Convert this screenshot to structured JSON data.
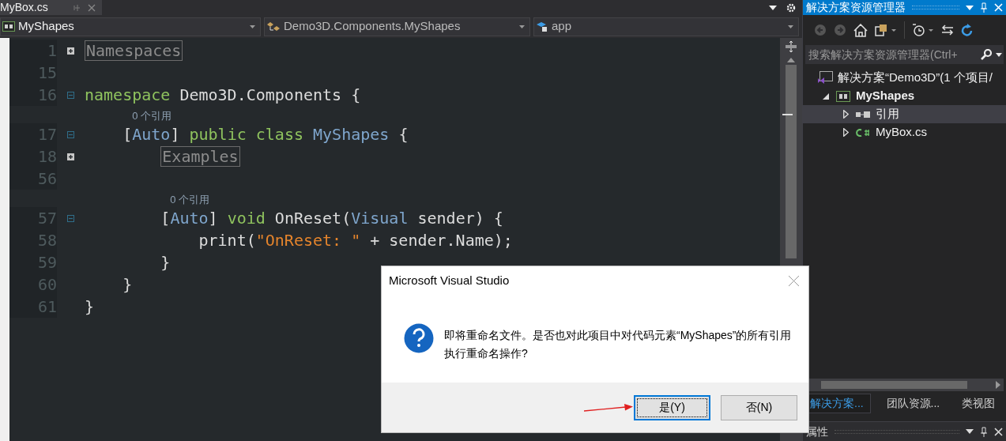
{
  "document_tab": {
    "title": "MyBox.cs"
  },
  "nav_bar": [
    {
      "text": "MyShapes",
      "kind": "project"
    },
    {
      "text": "Demo3D.Components.MyShapes",
      "kind": "class"
    },
    {
      "text": "app",
      "kind": "member"
    }
  ],
  "code_lines": [
    {
      "number": "1",
      "folded": true,
      "tokens": [
        {
          "text": "Namespaces",
          "kind": "collapsed"
        }
      ]
    },
    {
      "number": "15"
    },
    {
      "number": "16",
      "folded": false,
      "tokens": [
        {
          "text": "namespace",
          "kind": "keyword"
        },
        {
          "text": " Demo3D.Components {",
          "kind": "plain"
        }
      ]
    },
    {
      "number": "17",
      "lens": "0 个引用",
      "folded": false,
      "tokens": [
        {
          "text": "    [",
          "kind": "plain"
        },
        {
          "text": "Auto",
          "kind": "type"
        },
        {
          "text": "] ",
          "kind": "plain"
        },
        {
          "text": "public class",
          "kind": "keyword"
        },
        {
          "text": " MyShapes",
          "kind": "type"
        },
        {
          "text": " {",
          "kind": "plain"
        }
      ]
    },
    {
      "number": "18",
      "folded": true,
      "tokens": [
        {
          "text": "        Examples",
          "kind": "collapsed"
        }
      ]
    },
    {
      "number": "56"
    },
    {
      "number": "57",
      "lens": "0 个引用",
      "folded": false,
      "tokens": [
        {
          "text": "        [",
          "kind": "plain"
        },
        {
          "text": "Auto",
          "kind": "type"
        },
        {
          "text": "] ",
          "kind": "plain"
        },
        {
          "text": "void",
          "kind": "keyword"
        },
        {
          "text": " OnReset(",
          "kind": "plain"
        },
        {
          "text": "Visual",
          "kind": "type"
        },
        {
          "text": " sender) {",
          "kind": "plain"
        }
      ]
    },
    {
      "number": "58",
      "tokens": [
        {
          "text": "            print(",
          "kind": "plain"
        },
        {
          "text": "\"OnReset: \"",
          "kind": "string"
        },
        {
          "text": " + sender.Name);",
          "kind": "plain"
        }
      ]
    },
    {
      "number": "59",
      "tokens": [
        {
          "text": "        }",
          "kind": "plain"
        }
      ]
    },
    {
      "number": "60",
      "tokens": [
        {
          "text": "    }",
          "kind": "plain"
        }
      ]
    },
    {
      "number": "61",
      "tokens": [
        {
          "text": "}",
          "kind": "plain"
        }
      ]
    }
  ],
  "solution_explorer": {
    "title": "解决方案资源管理器",
    "search": {
      "placeholder": "搜索解决方案资源管理器(Ctrl+"
    },
    "tree": [
      {
        "label": "解决方案“Demo3D”(1 个项目/",
        "kind": "solution",
        "selected": false,
        "children": [
          {
            "label": "MyShapes",
            "kind": "project",
            "expanded": true,
            "selected": false,
            "children": [
              {
                "label": "引用",
                "kind": "references",
                "expanded": false,
                "selected": true
              },
              {
                "label": "MyBox.cs",
                "kind": "file",
                "expanded": false,
                "selected": false
              }
            ]
          }
        ]
      }
    ],
    "tabs": [
      {
        "label": "解决方案...",
        "selected": true
      },
      {
        "label": "团队资源...",
        "selected": false
      },
      {
        "label": "类视图",
        "selected": false
      }
    ]
  },
  "properties_panel": {
    "title": "属性"
  },
  "dialog": {
    "title": "Microsoft Visual Studio",
    "message": "即将重命名文件。是否也对此项目中对代码元素“MyShapes”的所有引用执行重命名操作?",
    "buttons": [
      {
        "label": "是(Y)",
        "selected": true
      },
      {
        "label": "否(N)",
        "selected": false
      }
    ]
  }
}
